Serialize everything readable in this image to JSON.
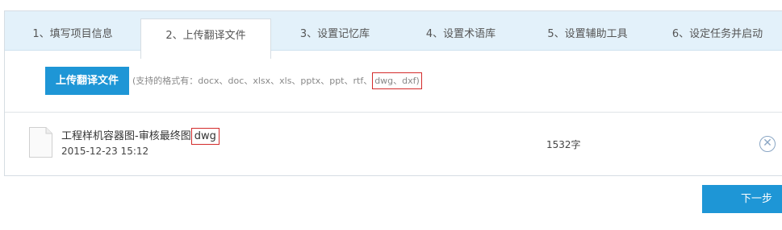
{
  "steps": [
    {
      "label": "1、填写项目信息"
    },
    {
      "label": "2、上传翻译文件"
    },
    {
      "label": "3、设置记忆库"
    },
    {
      "label": "4、设置术语库"
    },
    {
      "label": "5、设置辅助工具"
    },
    {
      "label": "6、设定任务并启动"
    }
  ],
  "active_step": 2,
  "upload": {
    "button_label": "上传翻译文件",
    "hint_prefix": "(支持的格式有：docx、doc、xlsx、xls、pptx、ppt、rtf、",
    "hint_highlight": "dwg、dxf)"
  },
  "file": {
    "name": "工程样机容器图-审核最终图",
    "ext": "dwg",
    "date": "2015-12-23 15:12",
    "word_count": "1532字",
    "remove_icon": "close-circle-icon"
  },
  "next_label": "下一步",
  "colors": {
    "accent": "#1e96d6",
    "tab_bar": "#e3f1fa",
    "highlight": "#d32b2b"
  }
}
